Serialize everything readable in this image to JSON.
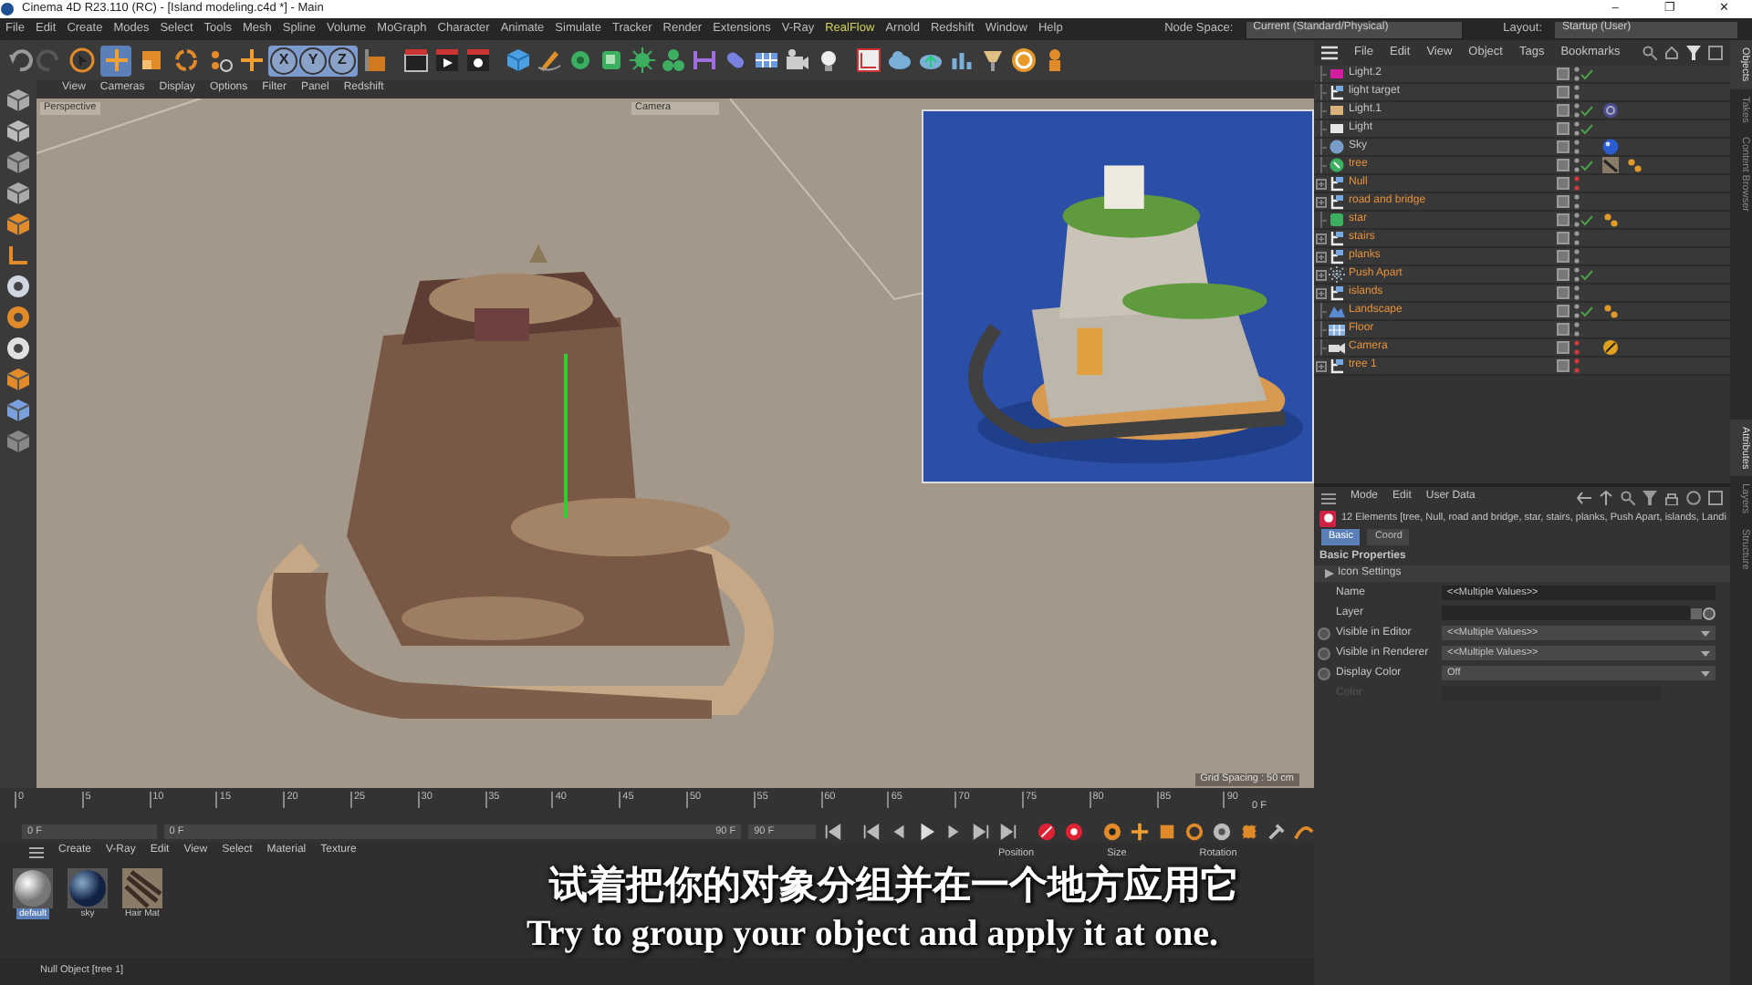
{
  "window": {
    "title": "Cinema 4D R23.110 (RC) - [Island modeling.c4d *] - Main",
    "controls": [
      "–",
      "❐",
      "✕"
    ]
  },
  "menu": [
    {
      "label": "File"
    },
    {
      "label": "Edit"
    },
    {
      "label": "Create"
    },
    {
      "label": "Modes"
    },
    {
      "label": "Select"
    },
    {
      "label": "Tools"
    },
    {
      "label": "Mesh"
    },
    {
      "label": "Spline"
    },
    {
      "label": "Volume"
    },
    {
      "label": "MoGraph"
    },
    {
      "label": "Character"
    },
    {
      "label": "Animate"
    },
    {
      "label": "Simulate"
    },
    {
      "label": "Tracker"
    },
    {
      "label": "Render"
    },
    {
      "label": "Extensions"
    },
    {
      "label": "V-Ray"
    },
    {
      "label": "RealFlow",
      "color": "#d2d25a"
    },
    {
      "label": "Arnold"
    },
    {
      "label": "Redshift"
    },
    {
      "label": "Window"
    },
    {
      "label": "Help"
    }
  ],
  "node_space": {
    "label": "Node Space:",
    "value": "Current (Standard/Physical)"
  },
  "layout": {
    "label": "Layout:",
    "value": "Startup (User)"
  },
  "tools": [
    {
      "selected": false
    },
    {
      "selected": true
    },
    {
      "selected": false
    },
    {
      "selected": false
    },
    {
      "selected": false
    }
  ],
  "axes": [
    {
      "label": "X",
      "on": true
    },
    {
      "label": "Y",
      "on": true
    },
    {
      "label": "Z",
      "on": true
    }
  ],
  "viewport": {
    "menu": [
      "View",
      "Cameras",
      "Display",
      "Options",
      "Filter",
      "Panel",
      "Redshift"
    ],
    "view_label": "Perspective",
    "camera": "Camera",
    "grid_spacing": "Grid Spacing : 50 cm"
  },
  "timeline": {
    "ticks": [
      "0",
      "5",
      "10",
      "15",
      "20",
      "25",
      "30",
      "35",
      "40",
      "45",
      "50",
      "55",
      "60",
      "65",
      "70",
      "75",
      "80",
      "85",
      "90"
    ],
    "current": "0 F",
    "start_field": "0 F",
    "range_start": "0 F",
    "range_end": "90 F",
    "max_field": "90 F"
  },
  "materials": {
    "menu": [
      "Create",
      "V-Ray",
      "Edit",
      "View",
      "Select",
      "Material",
      "Texture"
    ],
    "items": [
      {
        "name": "default",
        "kind": "white",
        "selected": true
      },
      {
        "name": "sky",
        "kind": "blue",
        "selected": false
      },
      {
        "name": "Hair Mat",
        "kind": "hair",
        "selected": false
      }
    ]
  },
  "coordinates": {
    "headers": [
      "Position",
      "Size",
      "Rotation"
    ]
  },
  "objects": {
    "menu": [
      "File",
      "Edit",
      "View",
      "Object",
      "Tags",
      "Bookmarks"
    ],
    "rows": [
      {
        "name": "Light.2",
        "kind": "light",
        "color": "#d21e9e",
        "selected": false,
        "has_children": false,
        "enabled": true,
        "hidden": false,
        "tags": []
      },
      {
        "name": "light target",
        "kind": "null",
        "selected": false,
        "has_children": false,
        "enabled": false,
        "hidden": false,
        "tags": []
      },
      {
        "name": "Light.1",
        "kind": "light",
        "color": "#d9b27a",
        "selected": false,
        "has_children": false,
        "enabled": true,
        "hidden": false,
        "tags": [
          {
            "kind": "target"
          }
        ]
      },
      {
        "name": "Light",
        "kind": "light",
        "color": "#e6e6e6",
        "selected": false,
        "has_children": false,
        "enabled": true,
        "hidden": false,
        "tags": []
      },
      {
        "name": "Sky",
        "kind": "sky",
        "selected": false,
        "has_children": false,
        "enabled": false,
        "hidden": false,
        "tags": [
          {
            "kind": "sphere"
          }
        ]
      },
      {
        "name": "tree",
        "kind": "cloner",
        "selected": true,
        "has_children": false,
        "enabled": true,
        "hidden": false,
        "tags": [
          {
            "kind": "hair"
          },
          {
            "kind": "points"
          }
        ]
      },
      {
        "name": "Null",
        "kind": "null",
        "selected": true,
        "has_children": true,
        "enabled": false,
        "hidden": true,
        "tags": []
      },
      {
        "name": "road and bridge",
        "kind": "null",
        "selected": true,
        "has_children": true,
        "enabled": false,
        "hidden": false,
        "tags": []
      },
      {
        "name": "star",
        "kind": "cube",
        "selected": true,
        "has_children": false,
        "enabled": true,
        "hidden": false,
        "tags": [
          {
            "kind": "points"
          }
        ]
      },
      {
        "name": "stairs",
        "kind": "null",
        "selected": true,
        "has_children": true,
        "enabled": false,
        "hidden": false,
        "tags": []
      },
      {
        "name": "planks",
        "kind": "null",
        "selected": true,
        "has_children": true,
        "enabled": false,
        "hidden": false,
        "tags": []
      },
      {
        "name": "Push Apart",
        "kind": "effector",
        "selected": true,
        "has_children": true,
        "enabled": true,
        "hidden": false,
        "tags": []
      },
      {
        "name": "islands",
        "kind": "null",
        "selected": true,
        "has_children": true,
        "enabled": false,
        "hidden": false,
        "tags": []
      },
      {
        "name": "Landscape",
        "kind": "landscape",
        "selected": true,
        "has_children": false,
        "enabled": true,
        "hidden": false,
        "tags": [
          {
            "kind": "points"
          }
        ]
      },
      {
        "name": "Floor",
        "kind": "floor",
        "selected": true,
        "has_children": false,
        "enabled": false,
        "hidden": false,
        "tags": []
      },
      {
        "name": "Camera",
        "kind": "camera",
        "selected": true,
        "has_children": false,
        "enabled": false,
        "hidden": true,
        "tags": [
          {
            "kind": "protection"
          }
        ]
      },
      {
        "name": "tree 1",
        "kind": "null",
        "selected": true,
        "has_children": true,
        "enabled": false,
        "hidden": true,
        "tags": []
      }
    ]
  },
  "attributes": {
    "menu": [
      "Mode",
      "Edit",
      "User Data"
    ],
    "summary": "12 Elements [tree, Null, road and bridge, star, stairs, planks, Push Apart, islands, Landi",
    "tabs": [
      {
        "label": "Basic",
        "selected": true
      },
      {
        "label": "Coord",
        "selected": false
      }
    ],
    "section": "Basic Properties",
    "group": "Icon Settings",
    "fields": [
      {
        "label": "Name",
        "kind": "text",
        "value": "<<Multiple Values>>",
        "disabled": false
      },
      {
        "label": "Layer",
        "kind": "link",
        "disabled": false
      },
      {
        "label": "Visible in Editor",
        "kind": "select",
        "value": "<<Multiple Values>>",
        "disabled": false
      },
      {
        "label": "Visible in Renderer",
        "kind": "select",
        "value": "<<Multiple Values>>",
        "disabled": false
      },
      {
        "label": "Display Color",
        "kind": "select",
        "value": "Off",
        "disabled": false
      },
      {
        "label": "Color",
        "kind": "color",
        "disabled": true
      }
    ]
  },
  "side_tabs_top": [
    {
      "label": "Objects",
      "selected": true
    },
    {
      "label": "Takes",
      "selected": false
    },
    {
      "label": "Content Browser",
      "selected": false
    }
  ],
  "side_tabs_bottom": [
    {
      "label": "Attributes",
      "selected": true
    },
    {
      "label": "Layers",
      "selected": false
    },
    {
      "label": "Structure",
      "selected": false
    }
  ],
  "status_bar": "Null Object [tree 1]",
  "subtitles": {
    "chinese": "试着把你的对象分组并在一个地方应用它",
    "english": "Try to group your object and apply it at one."
  }
}
